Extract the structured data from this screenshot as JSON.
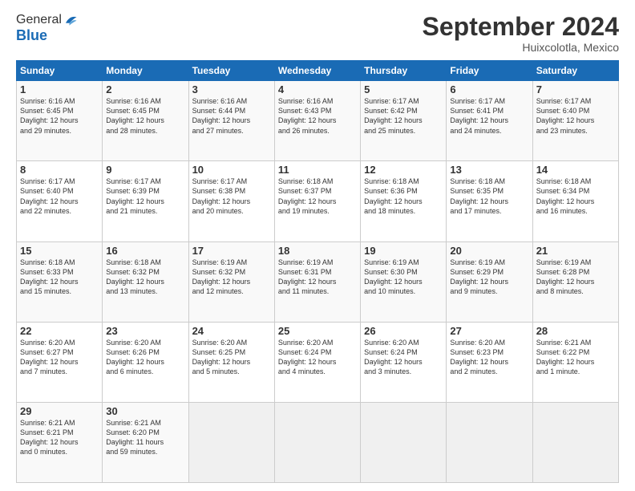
{
  "logo": {
    "general": "General",
    "blue": "Blue"
  },
  "title": "September 2024",
  "location": "Huixcolotla, Mexico",
  "days_of_week": [
    "Sunday",
    "Monday",
    "Tuesday",
    "Wednesday",
    "Thursday",
    "Friday",
    "Saturday"
  ],
  "weeks": [
    [
      {
        "day": "1",
        "info": "Sunrise: 6:16 AM\nSunset: 6:45 PM\nDaylight: 12 hours\nand 29 minutes."
      },
      {
        "day": "2",
        "info": "Sunrise: 6:16 AM\nSunset: 6:45 PM\nDaylight: 12 hours\nand 28 minutes."
      },
      {
        "day": "3",
        "info": "Sunrise: 6:16 AM\nSunset: 6:44 PM\nDaylight: 12 hours\nand 27 minutes."
      },
      {
        "day": "4",
        "info": "Sunrise: 6:16 AM\nSunset: 6:43 PM\nDaylight: 12 hours\nand 26 minutes."
      },
      {
        "day": "5",
        "info": "Sunrise: 6:17 AM\nSunset: 6:42 PM\nDaylight: 12 hours\nand 25 minutes."
      },
      {
        "day": "6",
        "info": "Sunrise: 6:17 AM\nSunset: 6:41 PM\nDaylight: 12 hours\nand 24 minutes."
      },
      {
        "day": "7",
        "info": "Sunrise: 6:17 AM\nSunset: 6:40 PM\nDaylight: 12 hours\nand 23 minutes."
      }
    ],
    [
      {
        "day": "8",
        "info": "Sunrise: 6:17 AM\nSunset: 6:40 PM\nDaylight: 12 hours\nand 22 minutes."
      },
      {
        "day": "9",
        "info": "Sunrise: 6:17 AM\nSunset: 6:39 PM\nDaylight: 12 hours\nand 21 minutes."
      },
      {
        "day": "10",
        "info": "Sunrise: 6:17 AM\nSunset: 6:38 PM\nDaylight: 12 hours\nand 20 minutes."
      },
      {
        "day": "11",
        "info": "Sunrise: 6:18 AM\nSunset: 6:37 PM\nDaylight: 12 hours\nand 19 minutes."
      },
      {
        "day": "12",
        "info": "Sunrise: 6:18 AM\nSunset: 6:36 PM\nDaylight: 12 hours\nand 18 minutes."
      },
      {
        "day": "13",
        "info": "Sunrise: 6:18 AM\nSunset: 6:35 PM\nDaylight: 12 hours\nand 17 minutes."
      },
      {
        "day": "14",
        "info": "Sunrise: 6:18 AM\nSunset: 6:34 PM\nDaylight: 12 hours\nand 16 minutes."
      }
    ],
    [
      {
        "day": "15",
        "info": "Sunrise: 6:18 AM\nSunset: 6:33 PM\nDaylight: 12 hours\nand 15 minutes."
      },
      {
        "day": "16",
        "info": "Sunrise: 6:18 AM\nSunset: 6:32 PM\nDaylight: 12 hours\nand 13 minutes."
      },
      {
        "day": "17",
        "info": "Sunrise: 6:19 AM\nSunset: 6:32 PM\nDaylight: 12 hours\nand 12 minutes."
      },
      {
        "day": "18",
        "info": "Sunrise: 6:19 AM\nSunset: 6:31 PM\nDaylight: 12 hours\nand 11 minutes."
      },
      {
        "day": "19",
        "info": "Sunrise: 6:19 AM\nSunset: 6:30 PM\nDaylight: 12 hours\nand 10 minutes."
      },
      {
        "day": "20",
        "info": "Sunrise: 6:19 AM\nSunset: 6:29 PM\nDaylight: 12 hours\nand 9 minutes."
      },
      {
        "day": "21",
        "info": "Sunrise: 6:19 AM\nSunset: 6:28 PM\nDaylight: 12 hours\nand 8 minutes."
      }
    ],
    [
      {
        "day": "22",
        "info": "Sunrise: 6:20 AM\nSunset: 6:27 PM\nDaylight: 12 hours\nand 7 minutes."
      },
      {
        "day": "23",
        "info": "Sunrise: 6:20 AM\nSunset: 6:26 PM\nDaylight: 12 hours\nand 6 minutes."
      },
      {
        "day": "24",
        "info": "Sunrise: 6:20 AM\nSunset: 6:25 PM\nDaylight: 12 hours\nand 5 minutes."
      },
      {
        "day": "25",
        "info": "Sunrise: 6:20 AM\nSunset: 6:24 PM\nDaylight: 12 hours\nand 4 minutes."
      },
      {
        "day": "26",
        "info": "Sunrise: 6:20 AM\nSunset: 6:24 PM\nDaylight: 12 hours\nand 3 minutes."
      },
      {
        "day": "27",
        "info": "Sunrise: 6:20 AM\nSunset: 6:23 PM\nDaylight: 12 hours\nand 2 minutes."
      },
      {
        "day": "28",
        "info": "Sunrise: 6:21 AM\nSunset: 6:22 PM\nDaylight: 12 hours\nand 1 minute."
      }
    ],
    [
      {
        "day": "29",
        "info": "Sunrise: 6:21 AM\nSunset: 6:21 PM\nDaylight: 12 hours\nand 0 minutes."
      },
      {
        "day": "30",
        "info": "Sunrise: 6:21 AM\nSunset: 6:20 PM\nDaylight: 11 hours\nand 59 minutes."
      },
      {
        "day": "",
        "info": ""
      },
      {
        "day": "",
        "info": ""
      },
      {
        "day": "",
        "info": ""
      },
      {
        "day": "",
        "info": ""
      },
      {
        "day": "",
        "info": ""
      }
    ]
  ]
}
